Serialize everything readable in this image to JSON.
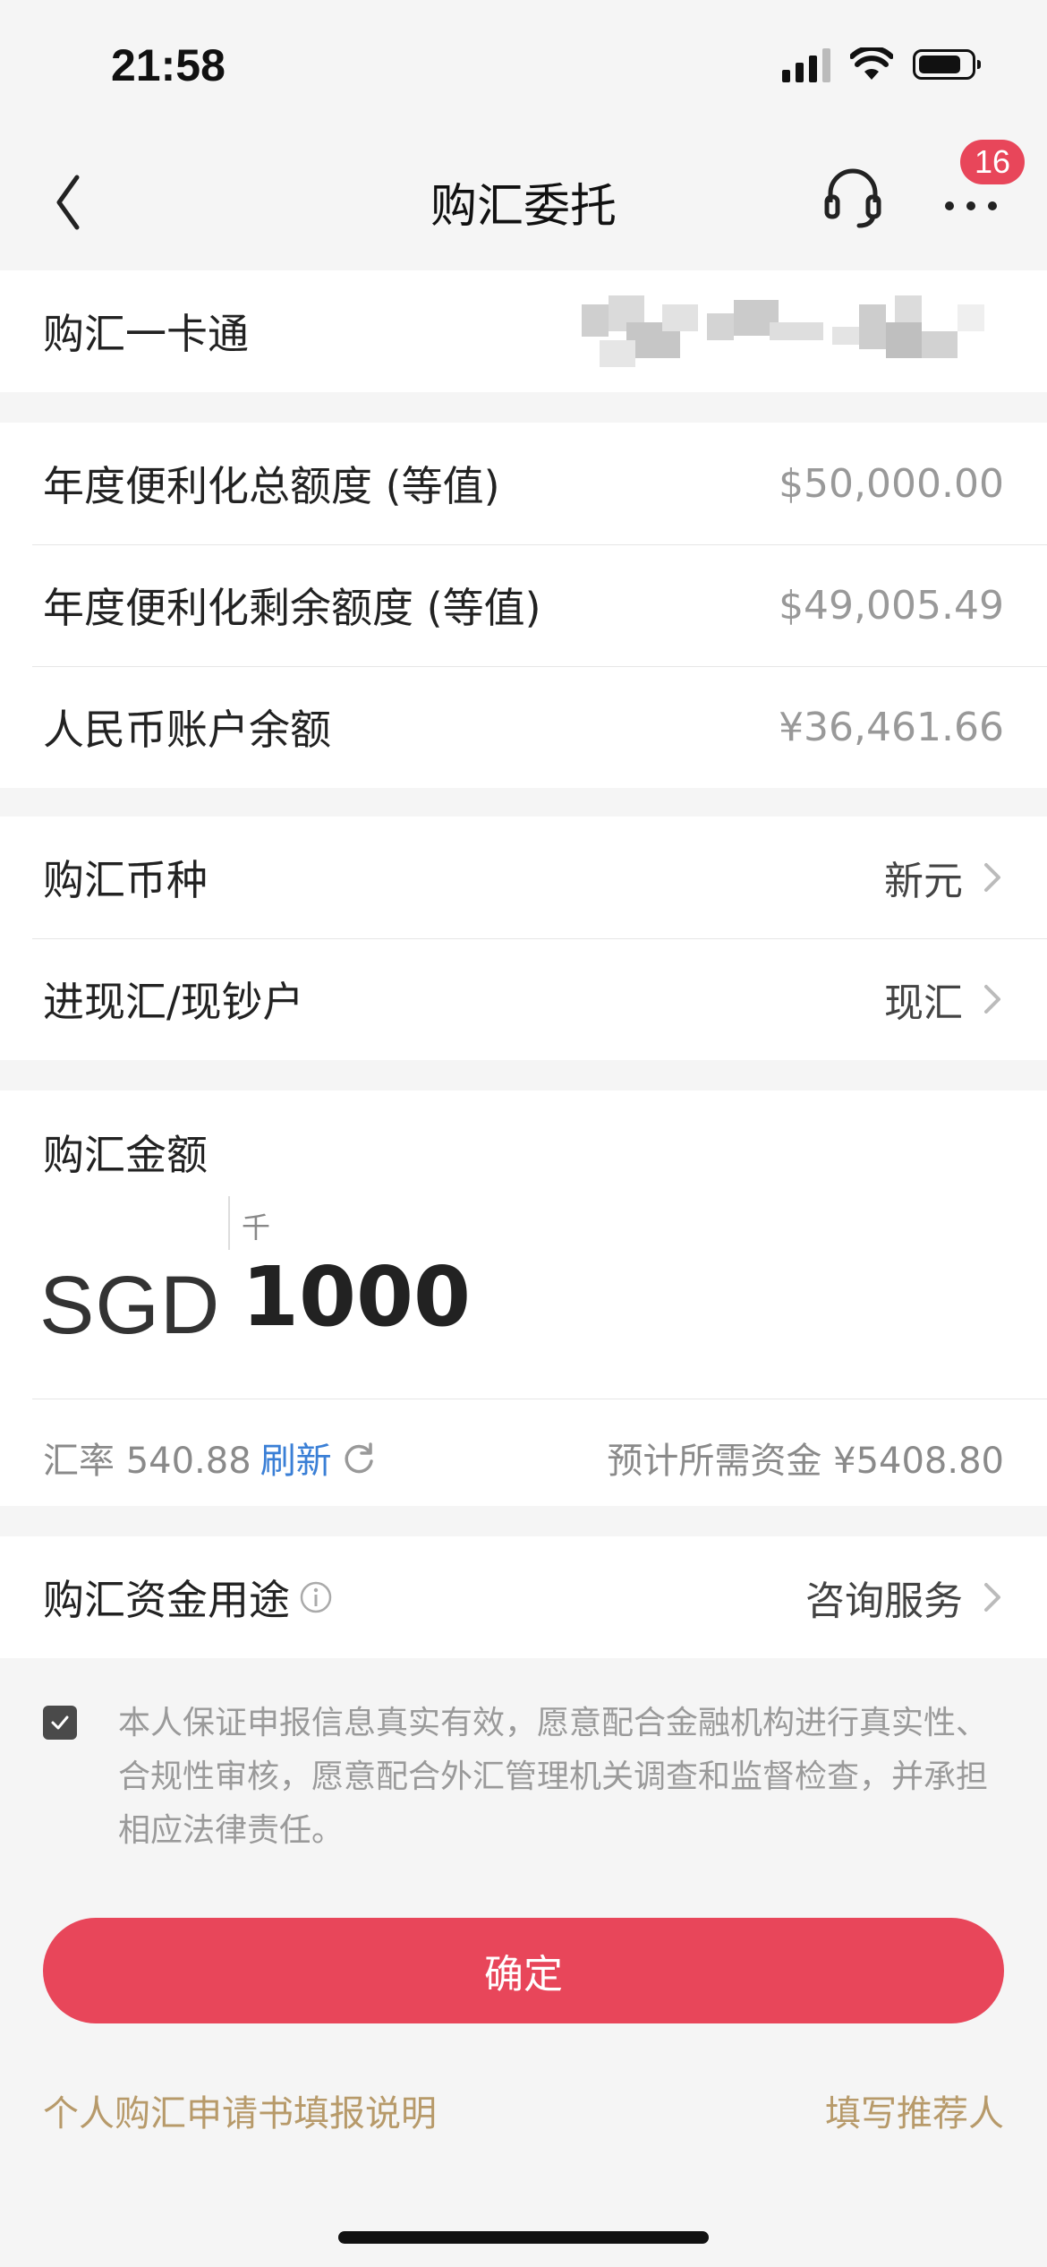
{
  "status_bar": {
    "time": "21:58"
  },
  "nav": {
    "title": "购汇委托",
    "badge_count": "16"
  },
  "card_row": {
    "label": "购汇一卡通"
  },
  "quota": {
    "rows": [
      {
        "label": "年度便利化总额度 (等值)",
        "value": "$50,000.00"
      },
      {
        "label": "年度便利化剩余额度 (等值)",
        "value": "$49,005.49"
      },
      {
        "label": "人民币账户余额",
        "value": "¥36,461.66"
      }
    ]
  },
  "options": {
    "currency": {
      "label": "购汇币种",
      "value": "新元"
    },
    "account_type": {
      "label": "进现汇/现钞户",
      "value": "现汇"
    }
  },
  "amount": {
    "label": "购汇金额",
    "unit_hint": "千",
    "currency_code": "SGD",
    "value": "1000",
    "rate_label": "汇率 540.88",
    "refresh_label": "刷新",
    "estimate_label": "预计所需资金 ¥5408.80"
  },
  "purpose": {
    "label": "购汇资金用途",
    "value": "咨询服务"
  },
  "declaration": {
    "checked": true,
    "text": "本人保证申报信息真实有效，愿意配合金融机构进行真实性、合规性审核，愿意配合外汇管理机关调查和监督检查，并承担相应法律责任。"
  },
  "actions": {
    "confirm_label": "确定",
    "guide_link": "个人购汇申请书填报说明",
    "referrer_link": "填写推荐人"
  },
  "colors": {
    "primary": "#e8465a",
    "link_blue": "#3a7fd6",
    "footer_gold": "#b79a6a"
  },
  "icons": [
    "back-icon",
    "headset-icon",
    "more-icon",
    "chevron-right-icon",
    "refresh-icon",
    "info-icon",
    "check-icon"
  ]
}
